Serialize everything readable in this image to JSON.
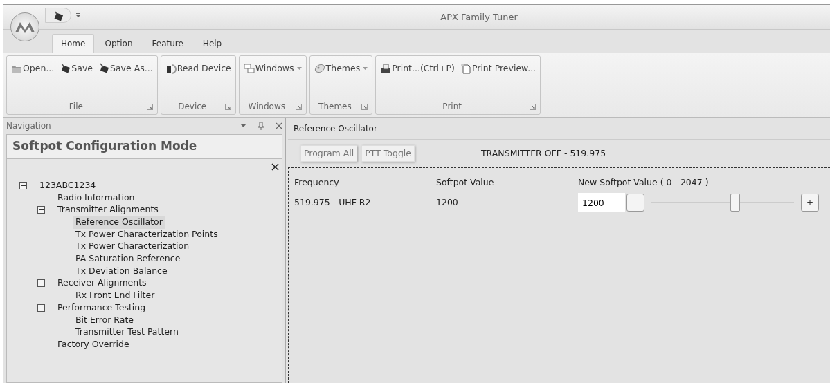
{
  "window": {
    "title": "APX Family Tuner"
  },
  "ribbon_tabs": [
    {
      "label": "Home",
      "selected": true
    },
    {
      "label": "Option",
      "selected": false
    },
    {
      "label": "Feature",
      "selected": false
    },
    {
      "label": "Help",
      "selected": false
    }
  ],
  "ribbon_groups": [
    {
      "label": "File",
      "buttons": [
        {
          "label": "Open...",
          "kind": "folder"
        },
        {
          "label": "Save",
          "kind": "radio"
        },
        {
          "label": "Save As...",
          "kind": "radio"
        }
      ]
    },
    {
      "label": "Device",
      "buttons": [
        {
          "label": "Read Device",
          "kind": "device"
        }
      ]
    },
    {
      "label": "Windows",
      "buttons": [
        {
          "label": "Windows",
          "kind": "windows",
          "dropdown": true
        }
      ]
    },
    {
      "label": "Themes",
      "buttons": [
        {
          "label": "Themes",
          "kind": "themes",
          "dropdown": true
        }
      ]
    },
    {
      "label": "Print",
      "buttons": [
        {
          "label": "Print...(Ctrl+P)",
          "kind": "printer"
        },
        {
          "label": "Print Preview...",
          "kind": "page"
        }
      ]
    }
  ],
  "navigation": {
    "title": "Navigation",
    "heading": "Softpot Configuration Mode",
    "tree": [
      {
        "label": "123ABC1234",
        "expanded": true,
        "selected": false,
        "children": [
          {
            "label": "Radio Information",
            "selected": false
          },
          {
            "label": "Transmitter Alignments",
            "expanded": true,
            "selected": false,
            "children": [
              {
                "label": "Reference Oscillator",
                "selected": true
              },
              {
                "label": "Tx Power Characterization Points",
                "selected": false
              },
              {
                "label": "Tx Power Characterization",
                "selected": false
              },
              {
                "label": "PA Saturation Reference",
                "selected": false
              },
              {
                "label": "Tx Deviation Balance",
                "selected": false
              }
            ]
          },
          {
            "label": "Receiver Alignments",
            "expanded": true,
            "selected": false,
            "children": [
              {
                "label": "Rx Front End Filter",
                "selected": false
              }
            ]
          },
          {
            "label": "Performance Testing",
            "expanded": true,
            "selected": false,
            "children": [
              {
                "label": "Bit Error Rate",
                "selected": false
              },
              {
                "label": "Transmitter Test Pattern",
                "selected": false
              }
            ]
          },
          {
            "label": "Factory Override",
            "selected": false
          }
        ]
      }
    ]
  },
  "document": {
    "tab": "Reference Oscillator",
    "buttons": [
      "Program All",
      "PTT Toggle"
    ],
    "status": "TRANSMITTER OFF - 519.975",
    "columns": [
      "Frequency",
      "Softpot Value",
      "New Softpot Value ( 0 - 2047 )"
    ],
    "rows": [
      {
        "frequency": "519.975 - UHF R2",
        "softpot_value": "1200",
        "new_value": "1200",
        "minus": "-",
        "plus": "+",
        "level": 0.586
      }
    ]
  }
}
